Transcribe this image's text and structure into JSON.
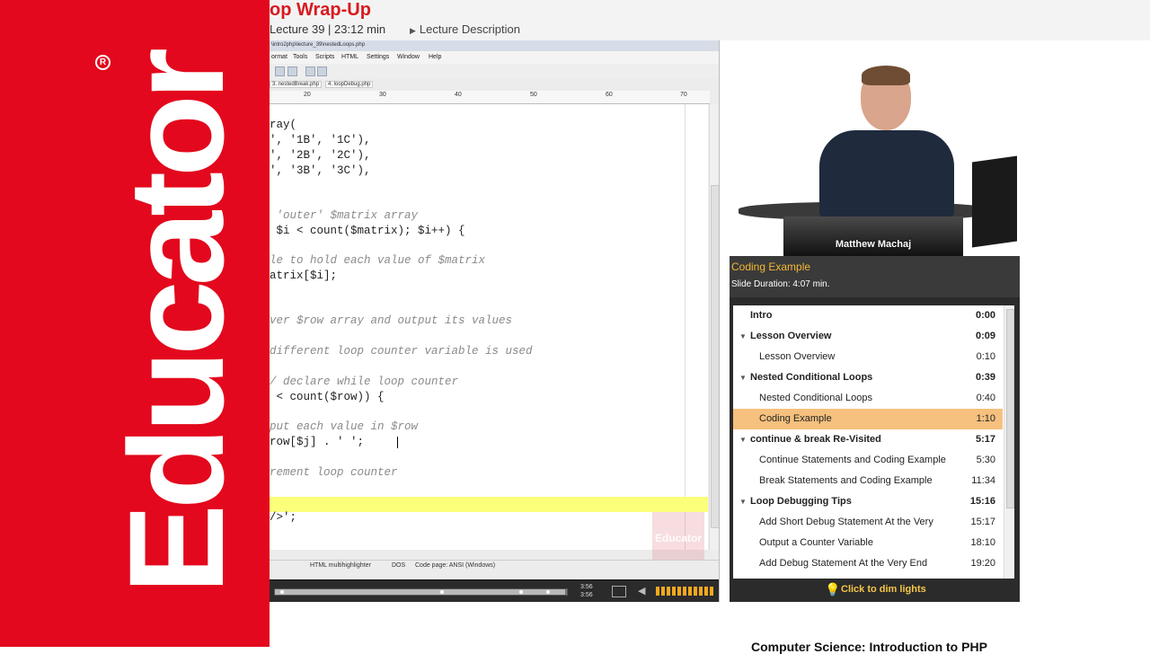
{
  "brand": {
    "name": "Educator",
    "reg": "R"
  },
  "header": {
    "title": "op Wrap-Up",
    "meta": "Lecture 39 | 23:12 min",
    "description": "Lecture Description"
  },
  "editor": {
    "window_title": "\\intro2php\\lecture_39\\nestedLoops.php",
    "menu": [
      "ormat",
      "Tools",
      "Scripts",
      "HTML",
      "Settings",
      "Window",
      "Help"
    ],
    "tabs": [
      "3. nestedBreak.php",
      "4. loopDebug.php"
    ],
    "ruler": [
      "20",
      "30",
      "40",
      "50",
      "60",
      "70"
    ],
    "code_lines": [
      {
        "text": "ray(",
        "kind": "code"
      },
      {
        "text": "', '1B', '1C'),",
        "kind": "code"
      },
      {
        "text": "', '2B', '2C'),",
        "kind": "code"
      },
      {
        "text": "', '3B', '3C'),",
        "kind": "code"
      },
      {
        "text": " 'outer' $matrix array",
        "kind": "comment"
      },
      {
        "text": " $i < count($matrix); $i++) {",
        "kind": "code"
      },
      {
        "text": "le to hold each value of $matrix",
        "kind": "comment"
      },
      {
        "text": "atrix[$i];",
        "kind": "code"
      },
      {
        "text": "ver $row array and output its values",
        "kind": "comment"
      },
      {
        "text": "different loop counter variable is used",
        "kind": "comment"
      },
      {
        "text": "/ declare while loop counter",
        "kind": "comment"
      },
      {
        "text": " < count($row)) {",
        "kind": "code"
      },
      {
        "text": "put each value in $row",
        "kind": "comment"
      },
      {
        "text": "row[$j] . ' ';",
        "kind": "code"
      },
      {
        "text": "rement loop counter",
        "kind": "comment"
      },
      {
        "text": "/>';",
        "kind": "code"
      }
    ],
    "watermark": "Educator",
    "status": [
      "HTML multihighlighter",
      "DOS",
      "Code page: ANSI (Windows)"
    ]
  },
  "player": {
    "time_current": "3:56",
    "time_total": "3:56",
    "progress": 0.995,
    "volume": 1.0
  },
  "video": {
    "presenter": "Matthew Machaj"
  },
  "slide": {
    "title": "Coding Example",
    "duration": "Slide Duration: 4:07 min."
  },
  "outline": [
    {
      "label": "Intro",
      "time": "0:00",
      "type": "top"
    },
    {
      "label": "Lesson Overview",
      "time": "0:09",
      "type": "section"
    },
    {
      "label": "Lesson Overview",
      "time": "0:10",
      "type": "item"
    },
    {
      "label": "Nested Conditional Loops",
      "time": "0:39",
      "type": "section"
    },
    {
      "label": "Nested Conditional Loops",
      "time": "0:40",
      "type": "item"
    },
    {
      "label": "Coding Example",
      "time": "1:10",
      "type": "active"
    },
    {
      "label": "continue & break Re-Visited",
      "time": "5:17",
      "type": "section"
    },
    {
      "label": "Continue Statements and Coding Example",
      "time": "5:30",
      "type": "item"
    },
    {
      "label": "Break Statements and Coding Example",
      "time": "11:34",
      "type": "item"
    },
    {
      "label": "Loop Debugging Tips",
      "time": "15:16",
      "type": "section"
    },
    {
      "label": "Add Short Debug Statement At the Very",
      "time": "15:17",
      "type": "item"
    },
    {
      "label": "Output a Counter Variable",
      "time": "18:10",
      "type": "item"
    },
    {
      "label": "Add Debug Statement At the Very End",
      "time": "19:20",
      "type": "item"
    }
  ],
  "dim_lights": "Click to dim lights",
  "footer": {
    "course_title": "Computer Science: Introduction to PHP"
  },
  "colors": {
    "brand_red": "#e3081d",
    "accent_orange": "#f6b732",
    "active_row": "#f6c07e",
    "highlight_line": "#fbff7a"
  }
}
